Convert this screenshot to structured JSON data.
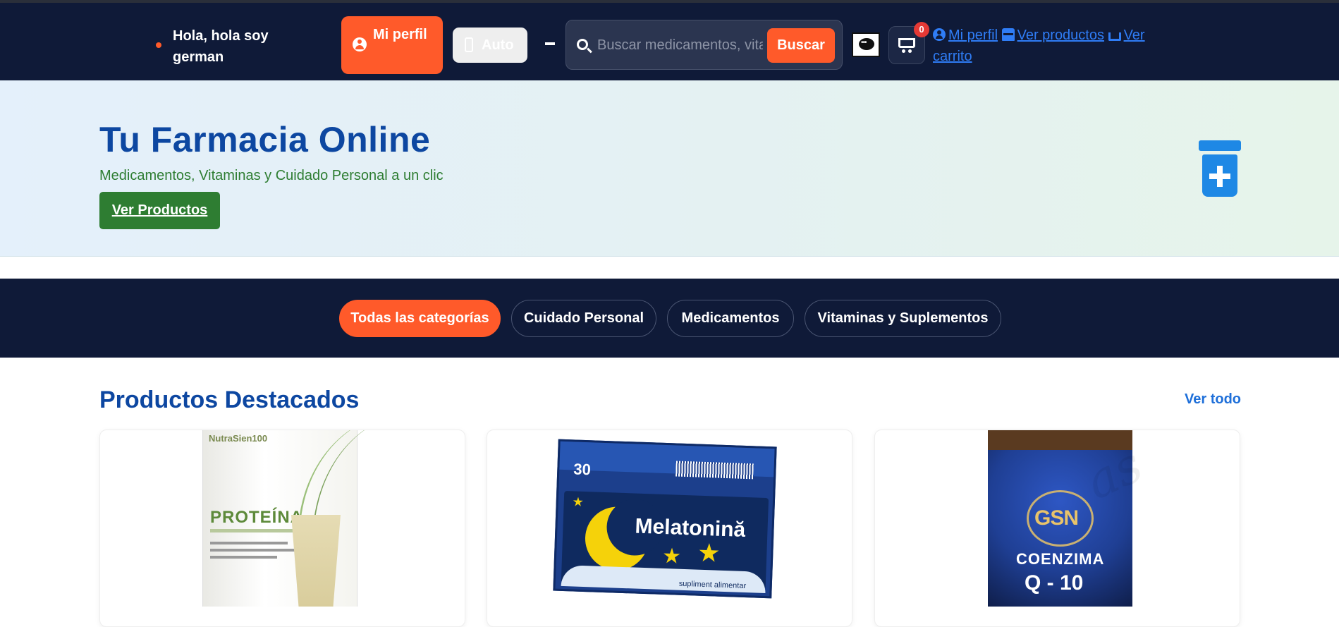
{
  "header": {
    "greeting": "Hola, hola soy german",
    "profile_button": "Mi perfil",
    "theme_button": "Auto",
    "search": {
      "placeholder": "Buscar medicamentos, vitaminas...",
      "value": "",
      "button": "Buscar"
    },
    "cart_count": "0",
    "links": {
      "profile": "Mi perfil",
      "products": "Ver productos",
      "cart": "Ver carrito"
    }
  },
  "hero": {
    "title": "Tu Farmacia Online",
    "subtitle": "Medicamentos, Vitaminas y Cuidado Personal a un clic",
    "cta": "Ver Productos"
  },
  "categories": [
    {
      "label": "Todas las categorías",
      "active": true
    },
    {
      "label": "Cuidado Personal",
      "active": false
    },
    {
      "label": "Medicamentos",
      "active": false
    },
    {
      "label": "Vitaminas y Suplementos",
      "active": false
    }
  ],
  "featured": {
    "title": "Productos Destacados",
    "see_all": "Ver todo",
    "products": [
      {
        "image_text": {
          "brand": "NutraSien100",
          "name": "PROTEÍNA"
        }
      },
      {
        "image_text": {
          "count": "30",
          "name": "Melatonină",
          "tag": "supliment alimentar"
        }
      },
      {
        "image_text": {
          "brand": "GSN",
          "name": "COENZIMA",
          "sub": "Q - 10"
        }
      }
    ]
  },
  "colors": {
    "navy": "#0f1a38",
    "accent": "#ff5a2a",
    "blue": "#0d47a1",
    "green": "#2e7d32",
    "link": "#2f7df6"
  }
}
